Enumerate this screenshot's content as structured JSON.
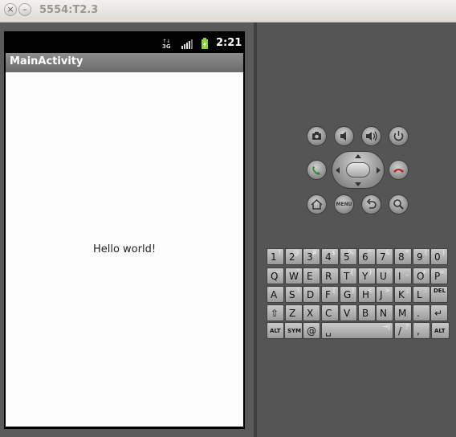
{
  "window": {
    "title": "5554:T2.3",
    "close_glyph": "×",
    "minimize_glyph": "–"
  },
  "status_bar": {
    "network": "3G",
    "time": "2:21",
    "signal_icon": "signal-icon",
    "battery_icon": "battery-charging-icon"
  },
  "app": {
    "title": "MainActivity",
    "content_text": "Hello world!"
  },
  "controls": {
    "row1": [
      "camera-icon",
      "volume-down-icon",
      "volume-up-icon",
      "power-icon"
    ],
    "row2": [
      "call-icon",
      "dpad",
      "end-call-icon"
    ],
    "row3": [
      "home-icon",
      "menu-button",
      "back-icon",
      "search-icon"
    ],
    "menu_label": "MENU"
  },
  "keyboard": {
    "rows": [
      [
        {
          "main": "1",
          "alt": "!"
        },
        {
          "main": "2",
          "alt": "@"
        },
        {
          "main": "3",
          "alt": "#"
        },
        {
          "main": "4",
          "alt": "$"
        },
        {
          "main": "5",
          "alt": "%"
        },
        {
          "main": "6",
          "alt": "^"
        },
        {
          "main": "7",
          "alt": "&"
        },
        {
          "main": "8",
          "alt": "*"
        },
        {
          "main": "9",
          "alt": "("
        },
        {
          "main": "0",
          "alt": ")"
        }
      ],
      [
        {
          "main": "Q",
          "alt": "~"
        },
        {
          "main": "W",
          "alt": "\""
        },
        {
          "main": "E",
          "alt": "´"
        },
        {
          "main": "R",
          "alt": ""
        },
        {
          "main": "T",
          "alt": "{"
        },
        {
          "main": "Y",
          "alt": "}"
        },
        {
          "main": "U",
          "alt": "-"
        },
        {
          "main": "I",
          "alt": "_"
        },
        {
          "main": "O",
          "alt": "+"
        },
        {
          "main": "P",
          "alt": "="
        }
      ],
      [
        {
          "main": "A",
          "alt": ""
        },
        {
          "main": "S",
          "alt": "\\"
        },
        {
          "main": "D",
          "alt": "'"
        },
        {
          "main": "F",
          "alt": "["
        },
        {
          "main": "G",
          "alt": "]"
        },
        {
          "main": "H",
          "alt": "<"
        },
        {
          "main": "J",
          "alt": ">"
        },
        {
          "main": "K",
          "alt": ";"
        },
        {
          "main": "L",
          "alt": ":"
        },
        {
          "main": "DEL",
          "alt": ""
        }
      ],
      [
        {
          "main": "⇧",
          "alt": ""
        },
        {
          "main": "Z",
          "alt": ""
        },
        {
          "main": "X",
          "alt": ""
        },
        {
          "main": "C",
          "alt": ""
        },
        {
          "main": "V",
          "alt": ""
        },
        {
          "main": "B",
          "alt": ""
        },
        {
          "main": "N",
          "alt": ""
        },
        {
          "main": "M",
          "alt": ""
        },
        {
          "main": ".",
          "alt": ""
        },
        {
          "main": "↵",
          "alt": ""
        }
      ],
      [
        {
          "main": "ALT",
          "alt": ""
        },
        {
          "main": "SYM",
          "alt": ""
        },
        {
          "main": "@",
          "alt": ""
        },
        {
          "main": "␣",
          "alt": "→|"
        },
        {
          "main": "/",
          "alt": "?"
        },
        {
          "main": ",",
          "alt": ""
        },
        {
          "main": "ALT",
          "alt": ""
        }
      ]
    ]
  }
}
